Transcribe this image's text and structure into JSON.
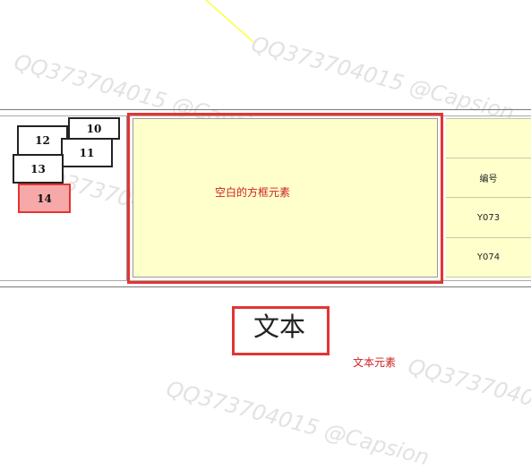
{
  "watermark": {
    "text": "QQ373704015 @Capsion"
  },
  "boxes": [
    {
      "label": "10"
    },
    {
      "label": "12"
    },
    {
      "label": "11"
    },
    {
      "label": "13"
    },
    {
      "label": "14"
    }
  ],
  "panel": {
    "label": "空白的方框元素"
  },
  "table": {
    "header": "编号",
    "rows": [
      "Y073",
      "Y074"
    ]
  },
  "text_element": {
    "text": "文本",
    "caption": "文本元素"
  },
  "colors": {
    "selection": "#e53333",
    "panel_fill": "#ffffcc",
    "selected_box_fill": "#f7a9a9",
    "guide_line": "#ffff33"
  }
}
